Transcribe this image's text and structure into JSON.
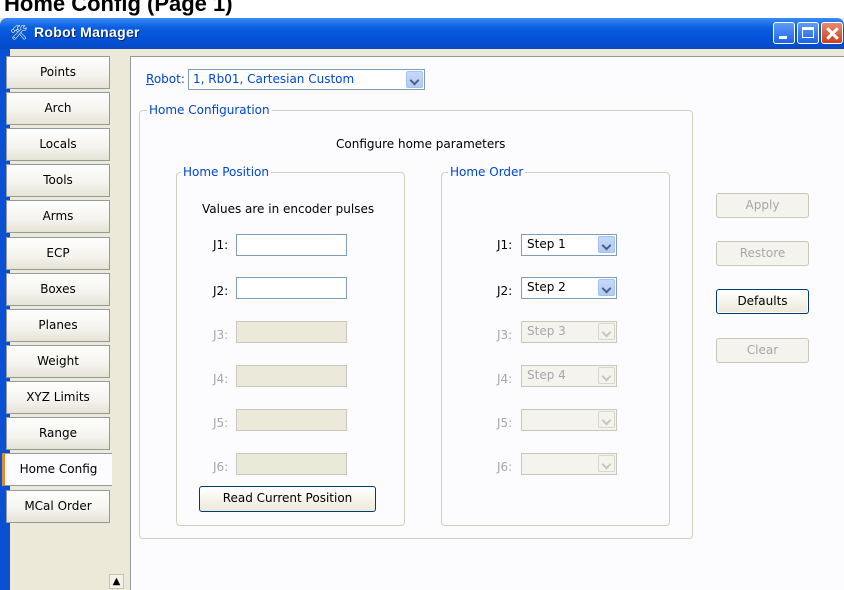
{
  "window": {
    "title": "Robot Manager"
  },
  "top_strip_text": "Home Config (Page 1)",
  "tabs": [
    {
      "label": "Points"
    },
    {
      "label": "Arch"
    },
    {
      "label": "Locals"
    },
    {
      "label": "Tools"
    },
    {
      "label": "Arms"
    },
    {
      "label": "ECP"
    },
    {
      "label": "Boxes"
    },
    {
      "label": "Planes"
    },
    {
      "label": "Weight"
    },
    {
      "label": "XYZ Limits"
    },
    {
      "label": "Range"
    },
    {
      "label": "Home Config",
      "active": true
    },
    {
      "label": "MCal Order"
    }
  ],
  "robot": {
    "label": "Robot:",
    "selected": "1, Rb01, Cartesian Custom"
  },
  "home_config": {
    "group_title": "Home Configuration",
    "heading": "Configure home parameters",
    "position": {
      "title": "Home Position",
      "note": "Values are in encoder pulses",
      "joints": [
        {
          "label": "J1:",
          "value": "",
          "enabled": true
        },
        {
          "label": "J2:",
          "value": "",
          "enabled": true
        },
        {
          "label": "J3:",
          "value": "",
          "enabled": false
        },
        {
          "label": "J4:",
          "value": "",
          "enabled": false
        },
        {
          "label": "J5:",
          "value": "",
          "enabled": false
        },
        {
          "label": "J6:",
          "value": "",
          "enabled": false
        }
      ],
      "read_button": "Read Current Position"
    },
    "order": {
      "title": "Home Order",
      "joints": [
        {
          "label": "J1:",
          "value": "Step 1",
          "enabled": true
        },
        {
          "label": "J2:",
          "value": "Step 2",
          "enabled": true
        },
        {
          "label": "J3:",
          "value": "Step 3",
          "enabled": false
        },
        {
          "label": "J4:",
          "value": "Step 4",
          "enabled": false
        },
        {
          "label": "J5:",
          "value": "",
          "enabled": false
        },
        {
          "label": "J6:",
          "value": "",
          "enabled": false
        }
      ]
    }
  },
  "actions": {
    "apply": {
      "label": "Apply",
      "enabled": false
    },
    "restore": {
      "label": "Restore",
      "enabled": false
    },
    "defaults": {
      "label": "Defaults",
      "enabled": true
    },
    "clear": {
      "label": "Clear",
      "enabled": false
    }
  },
  "colors": {
    "titlebar": "#0451d6",
    "active_tab_marker": "#e68b2c",
    "link_blue": "#0046d5",
    "disabled_text": "#a7a6aa"
  }
}
